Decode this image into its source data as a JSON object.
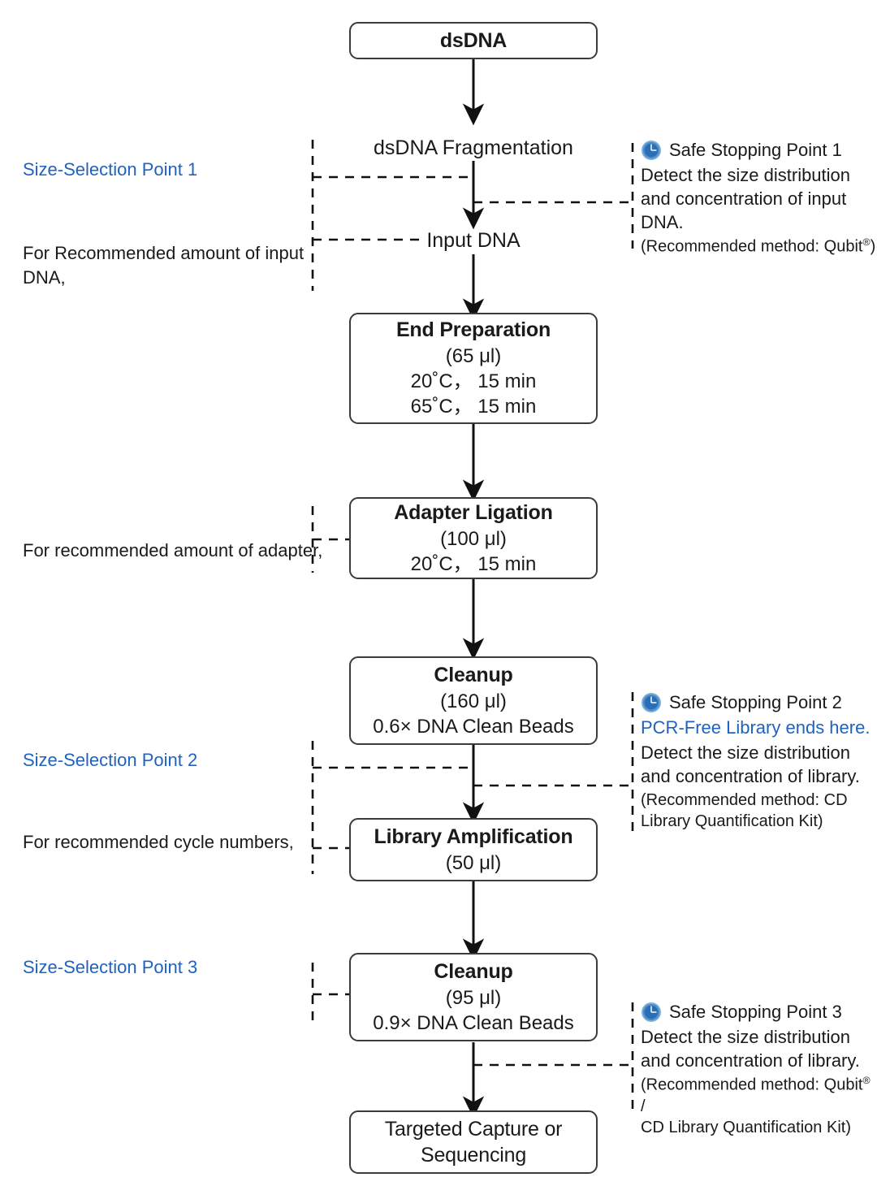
{
  "diagram": {
    "title": "dsDNA library preparation workflow",
    "accent_blue": "#1f62c0",
    "line_color": "#3b3b3b"
  },
  "nodes": {
    "dsdna": {
      "title": "dsDNA"
    },
    "fragmentation": {
      "title": "dsDNA Fragmentation"
    },
    "input_dna": {
      "title": "Input DNA"
    },
    "end_prep": {
      "title": "End Preparation",
      "volume": "(65 μl)",
      "line3": "20˚C， 15 min",
      "line4": "65˚C， 15 min"
    },
    "adapter_ligation": {
      "title": "Adapter Ligation",
      "volume": "(100 μl)",
      "line3": "20˚C， 15 min"
    },
    "cleanup1": {
      "title": "Cleanup",
      "volume": "(160 μl)",
      "line3": "0.6×  DNA Clean Beads"
    },
    "library_amplification": {
      "title": "Library Amplification",
      "volume": "(50 μl)"
    },
    "cleanup2": {
      "title": "Cleanup",
      "volume": "(95 μl)",
      "line3": "0.9× DNA Clean Beads"
    },
    "final": {
      "line1": "Targeted Capture or",
      "line2": "Sequencing"
    }
  },
  "left_notes": {
    "size_selection_1": "Size-Selection Point 1",
    "input_amount": {
      "line1": "For Recommended amount of input",
      "line2": "DNA,"
    },
    "adapter_amount": "For recommended amount of adapter,",
    "size_selection_2": "Size-Selection Point 2",
    "cycle_numbers": "For recommended cycle numbers,",
    "size_selection_3": "Size-Selection Point 3"
  },
  "right_notes": {
    "ssp1": {
      "icon": "clock-icon",
      "heading": "Safe Stopping Point 1",
      "body_line1": "Detect the size distribution",
      "body_line2": "and concentration of input",
      "body_line3": "DNA.",
      "method_line1": "(Recommended method: Qubit",
      "method_sup": "®",
      "method_tail": ")"
    },
    "ssp2": {
      "icon": "clock-icon",
      "heading": "Safe Stopping Point 2",
      "blue_line": "PCR-Free Library ends here.",
      "body_line1": "Detect the size distribution",
      "body_line2": "and concentration of library.",
      "method_line1": "(Recommended method: CD",
      "method_line2": "Library Quantification Kit)"
    },
    "ssp3": {
      "icon": "clock-icon",
      "heading": "Safe Stopping Point 3",
      "body_line1": "Detect the size distribution",
      "body_line2": "and concentration of library.",
      "method_line1": "(Recommended method: Qubit",
      "method_sup": "®",
      "method_tail": " /",
      "method_line2": "CD Library Quantification Kit)"
    }
  }
}
